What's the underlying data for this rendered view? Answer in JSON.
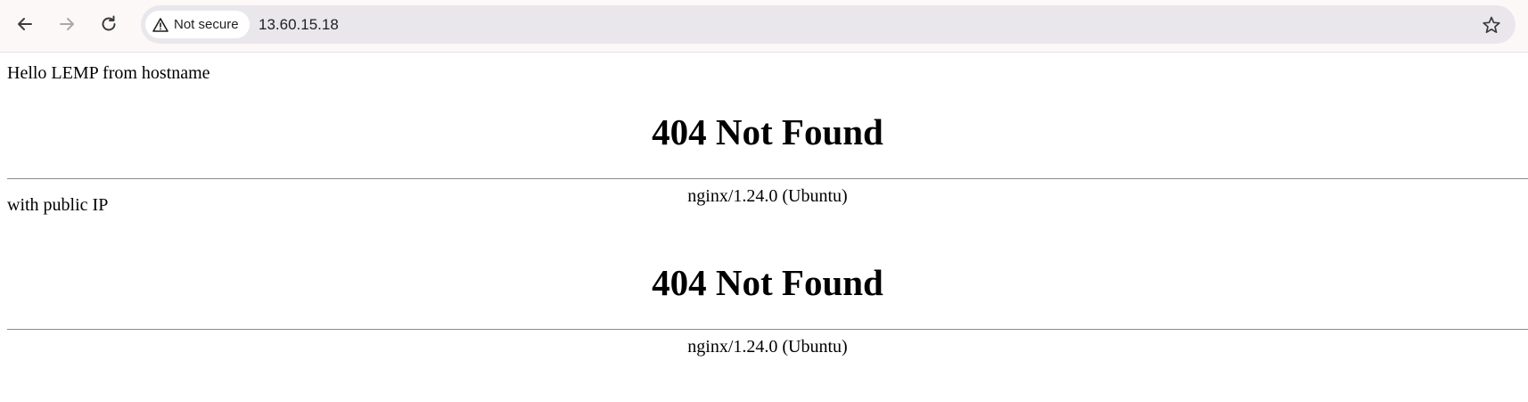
{
  "browser": {
    "security_label": "Not secure",
    "url": "13.60.15.18",
    "icons": {
      "back": "arrow-left-icon",
      "forward": "arrow-right-icon",
      "reload": "reload-icon",
      "security": "warning-triangle-icon",
      "bookmark": "star-icon"
    }
  },
  "content": {
    "greeting": "Hello LEMP from hostname",
    "blocks": [
      {
        "heading": "404 Not Found",
        "server": "nginx/1.24.0 (Ubuntu)"
      },
      {
        "heading": "404 Not Found",
        "server": "nginx/1.24.0 (Ubuntu)"
      }
    ],
    "middle_text": "with public IP"
  }
}
